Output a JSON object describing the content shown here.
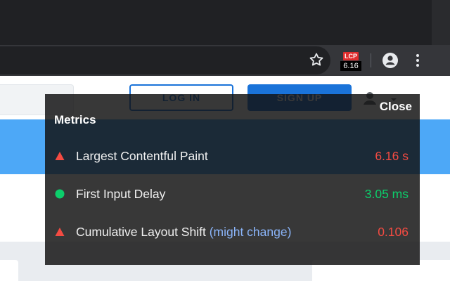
{
  "browser": {
    "lcp_badge_label": "LCP",
    "lcp_badge_value": "6.16"
  },
  "page": {
    "login_label": "LOG IN",
    "signup_label": "SIGN UP"
  },
  "overlay": {
    "title": "Metrics",
    "close_label": "Close",
    "metrics": [
      {
        "label": "Largest Contentful Paint",
        "note": "",
        "value": "6.16 s",
        "status": "poor",
        "icon": "triangle-warning-icon",
        "color": "#f44b42"
      },
      {
        "label": "First Input Delay",
        "note": "",
        "value": "3.05 ms",
        "status": "good",
        "icon": "circle-good-icon",
        "color": "#0cce6b"
      },
      {
        "label": "Cumulative Layout Shift",
        "note": "(might change)",
        "value": "0.106",
        "status": "poor",
        "icon": "triangle-warning-icon",
        "color": "#f44b42"
      }
    ]
  },
  "colors": {
    "poor": "#f44b42",
    "good": "#0cce6b",
    "note": "#8ab4f8",
    "brand_blue": "#1a73d9"
  }
}
